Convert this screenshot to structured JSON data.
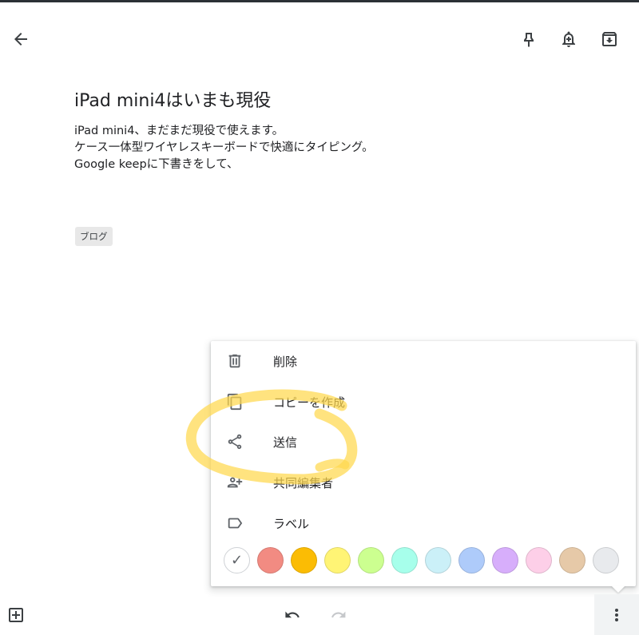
{
  "window": {
    "back_icon": "arrow-back-icon",
    "actions": [
      {
        "name": "pin-button",
        "icon": "pin-icon"
      },
      {
        "name": "reminder-button",
        "icon": "bell-plus-icon"
      },
      {
        "name": "archive-button",
        "icon": "archive-icon"
      }
    ]
  },
  "note": {
    "title": "iPad mini4はいまも現役",
    "body_lines": [
      "iPad mini4、まだまだ現役で使えます。",
      "ケース一体型ワイヤレスキーボードで快適にタイピング。",
      "Google keepに下書きをして、"
    ],
    "label": "ブログ"
  },
  "menu": {
    "items": [
      {
        "label": "削除",
        "icon": "trash-icon"
      },
      {
        "label": "コピーを作成",
        "icon": "copy-icon"
      },
      {
        "label": "送信",
        "icon": "share-icon"
      },
      {
        "label": "共同編集者",
        "icon": "person-add-icon"
      },
      {
        "label": "ラベル",
        "icon": "label-icon"
      }
    ],
    "colors": [
      {
        "name": "default",
        "hex": "#ffffff",
        "selected": true
      },
      {
        "name": "red",
        "hex": "#f28b82"
      },
      {
        "name": "orange",
        "hex": "#fbbc04"
      },
      {
        "name": "yellow",
        "hex": "#fff475"
      },
      {
        "name": "green",
        "hex": "#ccff90"
      },
      {
        "name": "teal",
        "hex": "#a7ffeb"
      },
      {
        "name": "blue",
        "hex": "#cbf0f8"
      },
      {
        "name": "dark-blue",
        "hex": "#aecbfa"
      },
      {
        "name": "purple",
        "hex": "#d7aefb"
      },
      {
        "name": "pink",
        "hex": "#fdcfe8"
      },
      {
        "name": "brown",
        "hex": "#e6c9a8"
      },
      {
        "name": "gray",
        "hex": "#e8eaed"
      }
    ]
  },
  "bottom_bar": {
    "add_icon": "add-box-icon",
    "undo_icon": "undo-icon",
    "redo_icon": "redo-icon",
    "more_icon": "more-vert-icon"
  },
  "annotation": {
    "color": "#ffd84d"
  }
}
